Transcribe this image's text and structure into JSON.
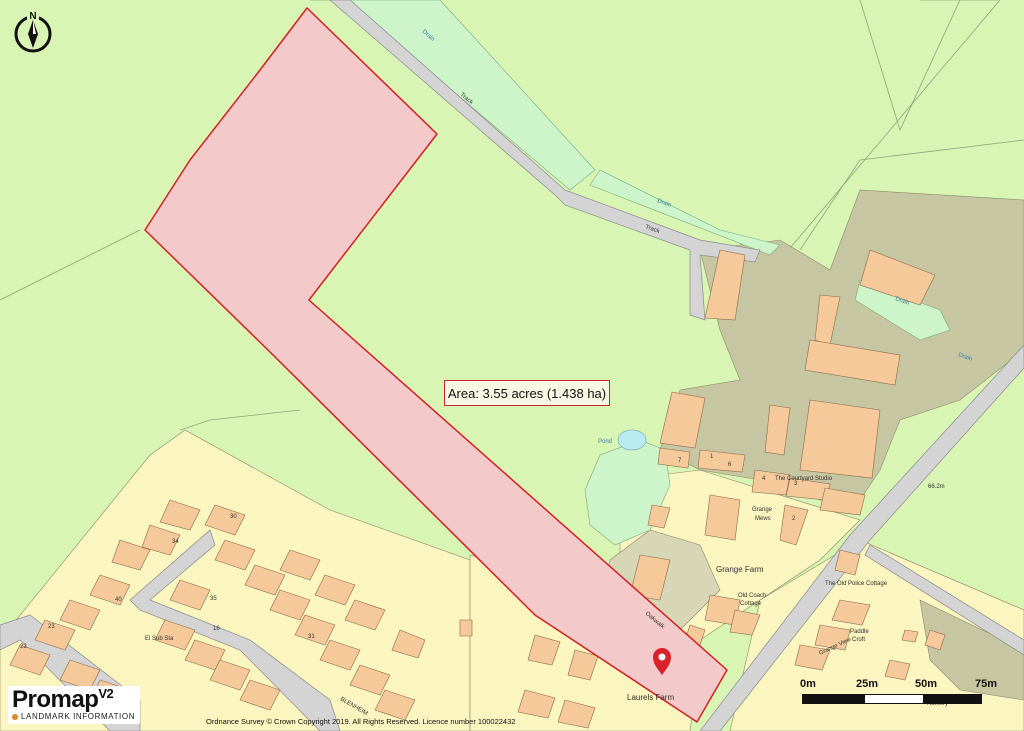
{
  "map": {
    "area_label": "Area: 3.55 acres (1.438 ha)",
    "north_label": "N",
    "place_labels": {
      "track_1": "Track",
      "track_2": "Track",
      "drain_1": "Drain",
      "drain_2": "Drain",
      "drain_3": "Drain",
      "drain_4": "Drain",
      "pond": "Pond",
      "courtyard_studio": "The Courtyard Studio",
      "grange_mews_1": "Grange",
      "grange_mews_2": "Mews",
      "grange_farm": "Grange Farm",
      "old_coach_cottage_1": "Old Coach",
      "old_coach_cottage_2": "Cottage",
      "oakwalk": "Oakwalk",
      "laurels_farm": "Laurels Farm",
      "el_sub_sta": "El Sub Sta",
      "old_police_cottage": "The Old Police Cottage",
      "spot_height": "66.2m",
      "blenheim": "BLENHEIM",
      "grange_view": "Grange View",
      "paddle_croft_1": "Paddle",
      "paddle_croft_2": "Croft",
      "nursery": "Nursery"
    },
    "house_numbers": [
      "30",
      "34",
      "40",
      "23",
      "22",
      "16",
      "31",
      "35",
      "1",
      "7",
      "6",
      "4",
      "3",
      "2"
    ],
    "colors": {
      "field": "#d9f5b3",
      "plot_fill": "#f4c9c9",
      "plot_border": "#d21f26",
      "building": "#f5c99a",
      "yard": "#c7c6a2",
      "residential": "#fbf5c0",
      "road": "#d4d4d4",
      "pond": "#b8ecf0",
      "pin": "#d9232a"
    }
  },
  "branding": {
    "logo_main": "Promap",
    "logo_version": "V2",
    "logo_sub": "LANDMARK INFORMATION"
  },
  "copyright": "Ordnance Survey © Crown Copyright 2019. All Rights Reserved. Licence number 100022432",
  "scale": {
    "labels": [
      "0m",
      "25m",
      "50m",
      "75m"
    ]
  }
}
